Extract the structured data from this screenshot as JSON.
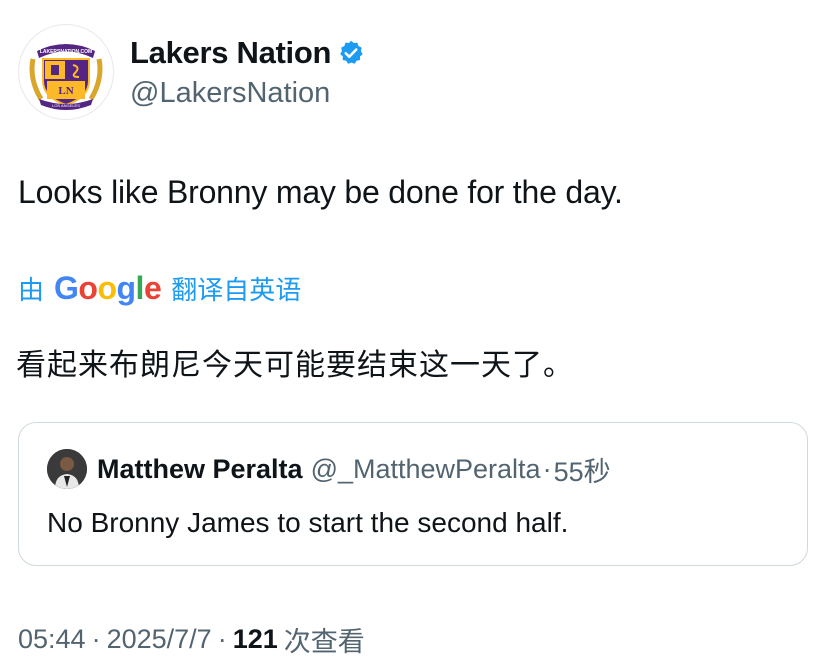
{
  "author": {
    "display_name": "Lakers Nation",
    "handle": "@LakersNation",
    "verified": true,
    "avatar": {
      "icon": "lakers-nation-crest",
      "top_text": "LAKERSNATION.COM",
      "monogram": "LN",
      "ribbon_text": "LOS ANGELES"
    }
  },
  "tweet": {
    "text": "Looks like Bronny may be done for the day.",
    "translation_prefix": "由",
    "translation_provider": "Google",
    "translation_suffix": "翻译自英语",
    "translated_text": "看起来布朗尼今天可能要结束这一天了。"
  },
  "quote": {
    "display_name": "Matthew Peralta",
    "handle": "@_MatthewPeralta",
    "separator": "·",
    "time": "55秒",
    "text": "No Bronny James to start the second half."
  },
  "meta": {
    "time": "05:44",
    "date": "2025/7/7",
    "separator": "·",
    "views_count": "121",
    "views_label": "次查看"
  },
  "colors": {
    "accent": "#1d9bf0",
    "secondary_text": "#536471",
    "lakers_purple": "#552583",
    "lakers_gold": "#fdb927"
  }
}
